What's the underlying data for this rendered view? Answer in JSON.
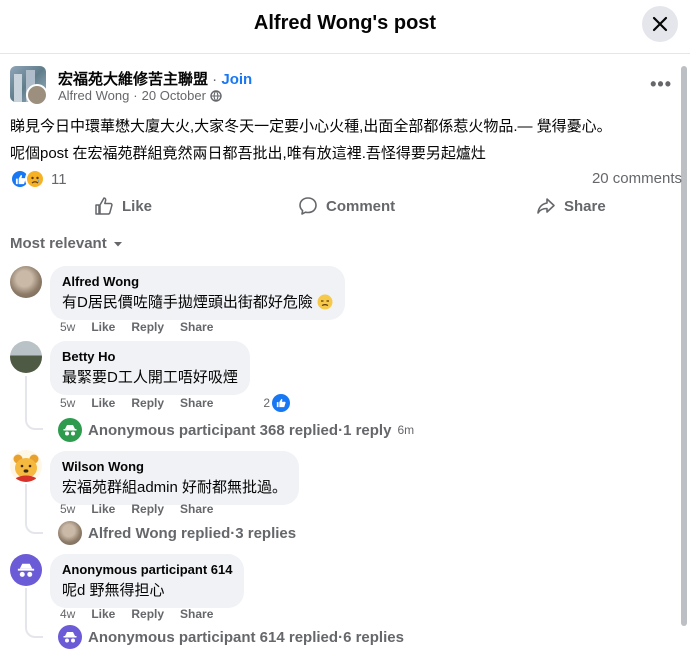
{
  "header": {
    "title": "Alfred Wong's post"
  },
  "post": {
    "group_name": "宏福苑大維修苦主聯盟",
    "join_sep": " · ",
    "join_label": "Join",
    "author": "Alfred Wong",
    "date": "20 October",
    "meta_sep": " · ",
    "text_line1": "睇見今日中環華懋大廈大火,大家冬天一定要小心火種,出面全部都係惹火物品.— 覺得憂心。",
    "text_line2": "呢個post 在宏福苑群組竟然兩日都吾批出,唯有放這裡.吾怪得要另起爐灶",
    "reaction_count": "11",
    "comments_count": "20 comments"
  },
  "actions": {
    "like": "Like",
    "comment": "Comment",
    "share": "Share"
  },
  "sort_label": "Most relevant",
  "comments": [
    {
      "name": "Alfred Wong",
      "text": "有D居民價咗隨手拋煙頭出街都好危險",
      "time": "5w",
      "like": "Like",
      "reply": "Reply",
      "share": "Share"
    },
    {
      "name": "Betty Ho",
      "text": "最緊要D工人開工唔好吸煙",
      "time": "5w",
      "like": "Like",
      "reply": "Reply",
      "share": "Share",
      "likes": "2",
      "replies_summary": {
        "who": "Anonymous participant 368 replied",
        "sep": " · ",
        "count": "1 reply",
        "time": "6m"
      }
    },
    {
      "name": "Wilson Wong",
      "text": "宏福苑群組admin 好耐都無批過。",
      "time": "5w",
      "like": "Like",
      "reply": "Reply",
      "share": "Share",
      "replies_summary": {
        "who": "Alfred Wong replied",
        "sep": " · ",
        "count": "3 replies"
      }
    },
    {
      "name": "Anonymous participant 614",
      "text": "呢d 野無得担心",
      "time": "4w",
      "like": "Like",
      "reply": "Reply",
      "share": "Share",
      "replies_summary": {
        "who": "Anonymous participant 614 replied",
        "sep": " · ",
        "count": "6 replies"
      }
    }
  ],
  "colors": {
    "accent": "#1877f2",
    "anon_green": "#2e9b4e",
    "anon_purple": "#6b5bd6"
  }
}
